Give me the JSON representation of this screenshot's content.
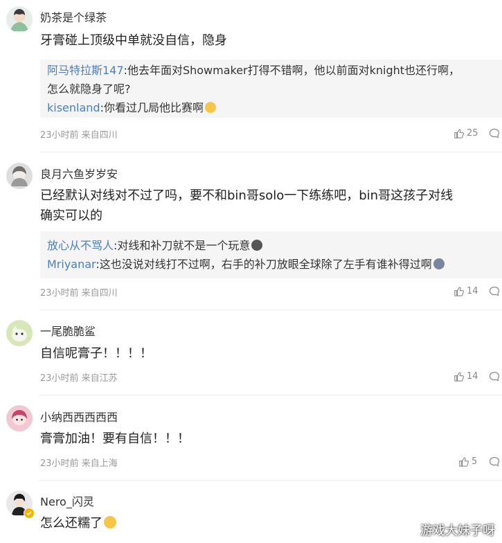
{
  "comments": [
    {
      "username": "奶茶是个绿茶",
      "text_lines": [
        "牙膏碰上顶级中单就没自信，隐身"
      ],
      "replies": [
        {
          "user": "阿马特拉斯147",
          "text_lines": [
            ":他去年面对Showmaker打得不错啊，他以前面对knight也还行啊，",
            "怎么就隐身了呢?"
          ]
        },
        {
          "user": "kisenland",
          "text_lines": [
            ":你看过几局他比赛啊"
          ]
        }
      ],
      "meta": "23小时前 来自四川",
      "likes": "25"
    },
    {
      "username": "良月六鱼岁岁安",
      "text_lines": [
        "已经默认对线对不过了吗，要不和bin哥solo一下练练吧，bin哥这孩子对线",
        "确实可以的"
      ],
      "replies": [
        {
          "user": "放心从不骂人",
          "text_lines": [
            ":对线和补刀就不是一个玩意"
          ]
        },
        {
          "user": "Mriyanar",
          "text_lines": [
            ":这也没说对线打不过啊，右手的补刀放眼全球除了左手有谁补得过啊"
          ]
        }
      ],
      "meta": "23小时前 来自四川",
      "likes": "14"
    },
    {
      "username": "一尾脆脆鲨",
      "text_lines": [
        "自信呢膏子！！！！"
      ],
      "replies": [],
      "meta": "23小时前 来自江苏",
      "likes": "14"
    },
    {
      "username": "小纳西西西西西",
      "text_lines": [
        "膏膏加油！要有自信！！！"
      ],
      "replies": [],
      "meta": "23小时前 来自上海",
      "likes": "5"
    },
    {
      "username": "Nero_闪灵",
      "text_lines": [
        "怎么还糯了"
      ],
      "replies": [],
      "meta": "",
      "likes": ""
    }
  ],
  "watermark": "游戏大妹子呀",
  "colors": {
    "reply_user": "#4a7fbf",
    "reply_bg": "#f5f5f5",
    "meta": "#999999"
  }
}
